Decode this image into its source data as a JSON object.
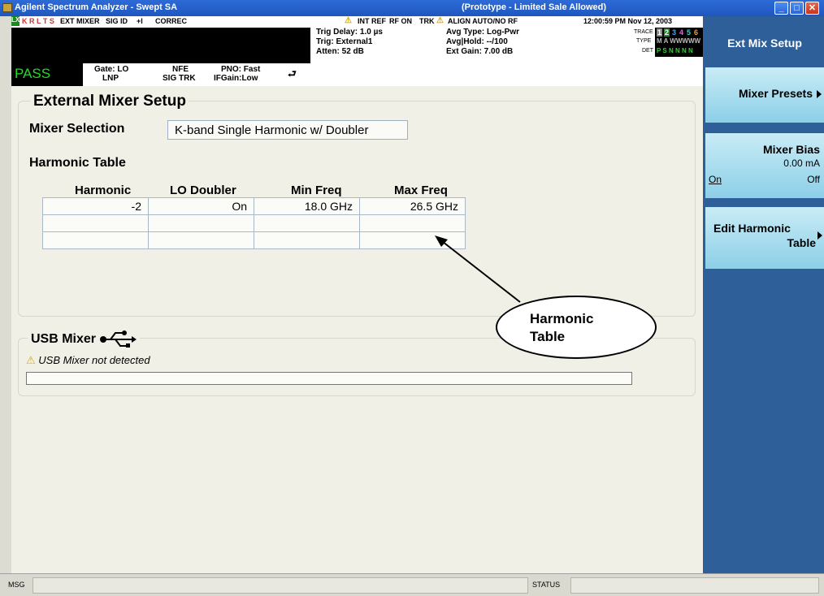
{
  "window": {
    "title": "Agilent Spectrum Analyzer - Swept SA",
    "subtitle": "(Prototype - Limited Sale Allowed)"
  },
  "status_row": {
    "indicators": "K R L T S",
    "ext_mixer": "EXT MIXER",
    "sig_id": "SIG ID",
    "plus_l": "+l",
    "correc": "CORREC",
    "int_ref": "INT REF",
    "rf_on": "RF ON",
    "trk": "TRK",
    "align": "ALIGN AUTO/NO RF",
    "datetime": "12:00:59 PM Nov 12, 2003"
  },
  "meas_info": {
    "pass": "PASS",
    "gate": "Gate: LO",
    "lnp": "LNP",
    "nfe": "NFE",
    "sig_trk": "SIG TRK",
    "pno": "PNO: Fast",
    "ifgain": "IFGain:Low",
    "trig_delay": "Trig Delay: 1.0 µs",
    "trig": "Trig: External1",
    "atten": "Atten: 52 dB",
    "avg_type": "Avg Type: Log-Pwr",
    "avg_hold": "Avg|Hold: --/100",
    "ext_gain": "Ext Gain: 7.00 dB",
    "trace_label": "TRACE",
    "type_label": "TYPE",
    "det_label": "DET",
    "trace_nums": [
      "1",
      "2",
      "3",
      "4",
      "5",
      "6"
    ],
    "type_val": "M A WWWWW",
    "det_val": "P S N N N N"
  },
  "external_mixer": {
    "title": "External Mixer Setup",
    "mixer_selection_label": "Mixer Selection",
    "mixer_selection_value": "K-band Single Harmonic w/ Doubler",
    "harmonic_table_label": "Harmonic Table",
    "columns": [
      "Harmonic",
      "LO Doubler",
      "Min Freq",
      "Max Freq"
    ],
    "rows": [
      [
        "-2",
        "On",
        "18.0 GHz",
        "26.5 GHz"
      ],
      [
        "",
        "",
        "",
        ""
      ],
      [
        "",
        "",
        "",
        ""
      ]
    ]
  },
  "usb_mixer": {
    "title": "USB Mixer",
    "status": "USB Mixer not detected"
  },
  "callout": {
    "line1": "Harmonic",
    "line2": "Table"
  },
  "softkeys": {
    "menu_title": "Ext Mix Setup",
    "mixer_presets": "Mixer Presets",
    "mixer_bias": "Mixer Bias",
    "mixer_bias_value": "0.00 mA",
    "on": "On",
    "off": "Off",
    "edit_harmonic_line1": "Edit Harmonic",
    "edit_harmonic_line2": "Table"
  },
  "bottom": {
    "msg": "MSG",
    "status": "STATUS"
  },
  "colors": {
    "pass_green": "#27d827",
    "softkey_blue": "#2f5f99",
    "panel_bg": "#f1f0e6",
    "warning_yellow": "#f2c200"
  }
}
